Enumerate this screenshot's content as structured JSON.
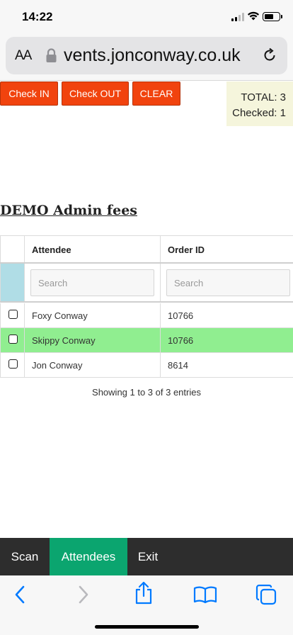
{
  "status": {
    "time": "14:22"
  },
  "browser": {
    "text_size_label": "AA",
    "url": "vents.jonconway.co.uk"
  },
  "actions": {
    "check_in": "Check IN",
    "check_out": "Check OUT",
    "clear": "CLEAR"
  },
  "summary": {
    "total": "TOTAL: 3",
    "checked": "Checked: 1"
  },
  "page": {
    "title": "DEMO Admin fees"
  },
  "table": {
    "columns": [
      "",
      "Attendee",
      "Order ID"
    ],
    "search_placeholders": [
      "Search",
      "Search"
    ],
    "rows": [
      {
        "attendee": "Foxy Conway",
        "order_id": "10766",
        "checked": false
      },
      {
        "attendee": "Skippy Conway",
        "order_id": "10766",
        "checked": true
      },
      {
        "attendee": "Jon Conway",
        "order_id": "8614",
        "checked": false
      }
    ],
    "info": "Showing 1 to 3 of 3 entries"
  },
  "nav": {
    "items": [
      "Scan",
      "Attendees",
      "Exit"
    ],
    "active": "Attendees"
  },
  "colors": {
    "action": "#f1430e",
    "checked_row": "#90ee90",
    "active_nav": "#0ba56f",
    "ios_blue": "#007aff"
  }
}
